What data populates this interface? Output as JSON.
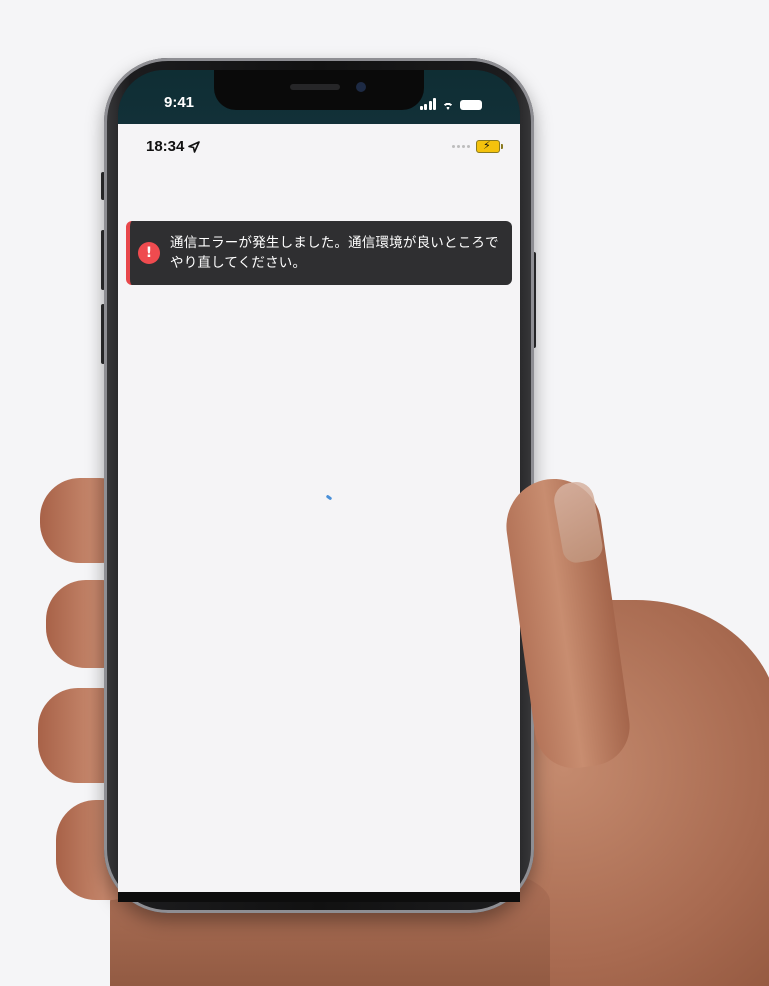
{
  "device": {
    "outer_status_time": "9:41"
  },
  "app": {
    "status_time": "18:34",
    "location_icon": "location-arrow-icon",
    "battery_icon": "battery-charging-icon",
    "battery_color": "#f4c20d"
  },
  "toast": {
    "icon": "exclamation-circle-icon",
    "message": "通信エラーが発生しました。通信環境が良いところでやり直してください。",
    "accent_color": "#e8474b",
    "background_color": "#2f2f31"
  },
  "loading": {
    "icon": "loading-spinner-icon",
    "color": "#4a90d9"
  }
}
